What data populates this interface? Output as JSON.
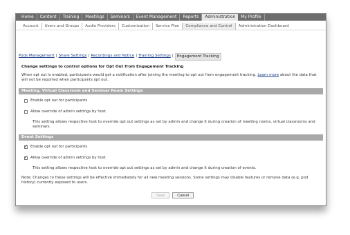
{
  "topnav": {
    "items": [
      "Home",
      "Content",
      "Training",
      "Meetings",
      "Seminars",
      "Event Management",
      "Reports",
      "Administration",
      "My Profile"
    ],
    "active": "Administration"
  },
  "subnav": {
    "items": [
      "Account",
      "Users and Groups",
      "Audio Providers",
      "Customization",
      "Service Plan",
      "Compliance and Control",
      "Administration Dashboard"
    ],
    "active": "Compliance and Control"
  },
  "tabs": {
    "items": [
      "Pods Management",
      "Share Settings",
      "Recordings and Notice",
      "Training Settings",
      "Engagement Tracking"
    ],
    "active": "Engagement Tracking"
  },
  "heading": "Change settings to control options for Opt Out from Engagement Tracking",
  "desc": {
    "text_before": "When opt out is enabled, participants would get a notification after joining the meeting to opt out from engagement tracking.",
    "link": "Learn more",
    "text_after": "about the data that will not be reported when participants opt out."
  },
  "section1": {
    "title": "Meeting, Virtual Classroom and Seminar Room Settings",
    "enable_label": "Enable opt out for participants",
    "enable_checked": false,
    "override_label": "Allow override of admin settings by host",
    "override_checked": false,
    "override_note": "This setting allows respective host to override opt out settings as set by admin and change it during creation of meeting rooms, virtual classrooms and seminars."
  },
  "section2": {
    "title": "Event Settings",
    "enable_label": "Enable opt out for participants",
    "enable_checked": true,
    "override_label": "Allow override of admin settings by host",
    "override_checked": true,
    "override_note": "This setting allows respective host to override opt out settings as set by admin and change it during creation of events."
  },
  "footer_note": "Note: Changes to these settings will be effective immediately for all new meeting sessions. Some settings may disable features or remove data (e.g. pod history) currently exposed to users.",
  "buttons": {
    "save": "Save",
    "cancel": "Cancel"
  }
}
